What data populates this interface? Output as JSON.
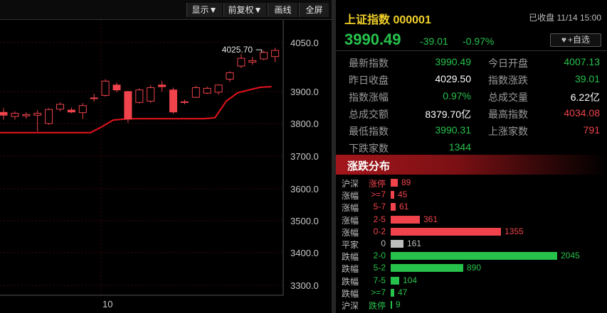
{
  "toolbar": {
    "buttons": [
      "显示▼",
      "前复权▼",
      "画线",
      "全屏"
    ]
  },
  "chart": {
    "price_axis_ticks": [
      "4050.0",
      "3900.0",
      "3800.0",
      "3700.0",
      "3600.0",
      "3500.0",
      "3400.0",
      "3300.0"
    ],
    "date_label": "10",
    "high_annotation": "4025.70",
    "colors": {
      "up": "#f0434b",
      "down": "#f0434b",
      "ma": "#e8131d",
      "grid": "#3a0c0e",
      "axis_text": "#c8c8c8"
    }
  },
  "chart_data": {
    "type": "candlestick",
    "y_axis_ticks": [
      4050.0,
      3900.0,
      3800.0,
      3700.0,
      3600.0,
      3500.0,
      3400.0,
      3300.0
    ],
    "x_label": "10",
    "annotation": "4025.70",
    "candles": [
      {
        "o": 3835,
        "h": 3848,
        "l": 3812,
        "c": 3826
      },
      {
        "o": 3822,
        "h": 3838,
        "l": 3812,
        "c": 3832
      },
      {
        "o": 3824,
        "h": 3835,
        "l": 3815,
        "c": 3828
      },
      {
        "o": 3826,
        "h": 3842,
        "l": 3776,
        "c": 3832
      },
      {
        "o": 3800,
        "h": 3848,
        "l": 3796,
        "c": 3844
      },
      {
        "o": 3845,
        "h": 3866,
        "l": 3838,
        "c": 3860
      },
      {
        "o": 3842,
        "h": 3850,
        "l": 3832,
        "c": 3836
      },
      {
        "o": 3834,
        "h": 3864,
        "l": 3814,
        "c": 3856
      },
      {
        "o": 3880,
        "h": 3893,
        "l": 3868,
        "c": 3880
      },
      {
        "o": 3888,
        "h": 3938,
        "l": 3884,
        "c": 3932
      },
      {
        "o": 3920,
        "h": 3928,
        "l": 3898,
        "c": 3905
      },
      {
        "o": 3900,
        "h": 3902,
        "l": 3802,
        "c": 3814
      },
      {
        "o": 3866,
        "h": 3910,
        "l": 3862,
        "c": 3905
      },
      {
        "o": 3870,
        "h": 3920,
        "l": 3865,
        "c": 3912
      },
      {
        "o": 3920,
        "h": 3932,
        "l": 3900,
        "c": 3915
      },
      {
        "o": 3905,
        "h": 3912,
        "l": 3830,
        "c": 3836
      },
      {
        "o": 3866,
        "h": 3875,
        "l": 3860,
        "c": 3868
      },
      {
        "o": 3882,
        "h": 3918,
        "l": 3880,
        "c": 3912
      },
      {
        "o": 3895,
        "h": 3915,
        "l": 3892,
        "c": 3910
      },
      {
        "o": 3898,
        "h": 3922,
        "l": 3890,
        "c": 3920
      },
      {
        "o": 3938,
        "h": 3962,
        "l": 3930,
        "c": 3958
      },
      {
        "o": 3978,
        "h": 4015,
        "l": 3972,
        "c": 4002
      },
      {
        "o": 3990,
        "h": 4006,
        "l": 3982,
        "c": 3995
      },
      {
        "o": 4000,
        "h": 4025.7,
        "l": 3996,
        "c": 4020
      },
      {
        "o": 4007.13,
        "h": 4034.08,
        "l": 3990.31,
        "c": 4026
      }
    ],
    "ma": [
      3772,
      3772,
      3772,
      3772,
      3772,
      3772,
      3772,
      3772,
      3772,
      3790,
      3811,
      3814,
      3815,
      3815,
      3815,
      3815,
      3815,
      3815,
      3815,
      3818,
      3870,
      3896,
      3905,
      3913,
      3915
    ]
  },
  "quote": {
    "name": "上证指数 000001",
    "status": "已收盘 11/14 15:00",
    "price": "3990.49",
    "change": "-39.01",
    "change_pct": "-0.97%",
    "fav_label": "+自选",
    "stats": [
      [
        {
          "label": "最新指数",
          "value": "3990.49",
          "color": "green"
        },
        {
          "label": "今日开盘",
          "value": "4007.13",
          "color": "green"
        }
      ],
      [
        {
          "label": "昨日收盘",
          "value": "4029.50",
          "color": "white"
        },
        {
          "label": "指数涨跌",
          "value": "39.01",
          "color": "green"
        }
      ],
      [
        {
          "label": "指数涨幅",
          "value": "0.97%",
          "color": "green"
        },
        {
          "label": "总成交量",
          "value": "6.22亿",
          "color": "white"
        }
      ],
      [
        {
          "label": "总成交额",
          "value": "8379.70亿",
          "color": "white"
        },
        {
          "label": "最高指数",
          "value": "4034.08",
          "color": "red"
        }
      ],
      [
        {
          "label": "最低指数",
          "value": "3990.31",
          "color": "green"
        },
        {
          "label": "上涨家数",
          "value": "791",
          "color": "red"
        }
      ],
      [
        {
          "label": "下跌家数",
          "value": "1344",
          "color": "green"
        }
      ]
    ]
  },
  "distribution": {
    "title": "涨跌分布",
    "rows": [
      {
        "type": "沪深",
        "range": "涨停",
        "count": 89,
        "kind": "up"
      },
      {
        "type": "涨幅",
        "range": ">=7",
        "count": 45,
        "kind": "up"
      },
      {
        "type": "涨幅",
        "range": "5-7",
        "count": 61,
        "kind": "up"
      },
      {
        "type": "涨幅",
        "range": "2-5",
        "count": 361,
        "kind": "up"
      },
      {
        "type": "涨幅",
        "range": "0-2",
        "count": 1355,
        "kind": "up"
      },
      {
        "type": "平家",
        "range": "0",
        "count": 161,
        "kind": "flat"
      },
      {
        "type": "跌幅",
        "range": "2-0",
        "count": 2045,
        "kind": "down"
      },
      {
        "type": "跌幅",
        "range": "5-2",
        "count": 890,
        "kind": "down"
      },
      {
        "type": "跌幅",
        "range": "7-5",
        "count": 104,
        "kind": "down"
      },
      {
        "type": "跌幅",
        "range": ">=7",
        "count": 47,
        "kind": "down"
      },
      {
        "type": "沪深",
        "range": "跌停",
        "count": 9,
        "kind": "down"
      }
    ]
  }
}
